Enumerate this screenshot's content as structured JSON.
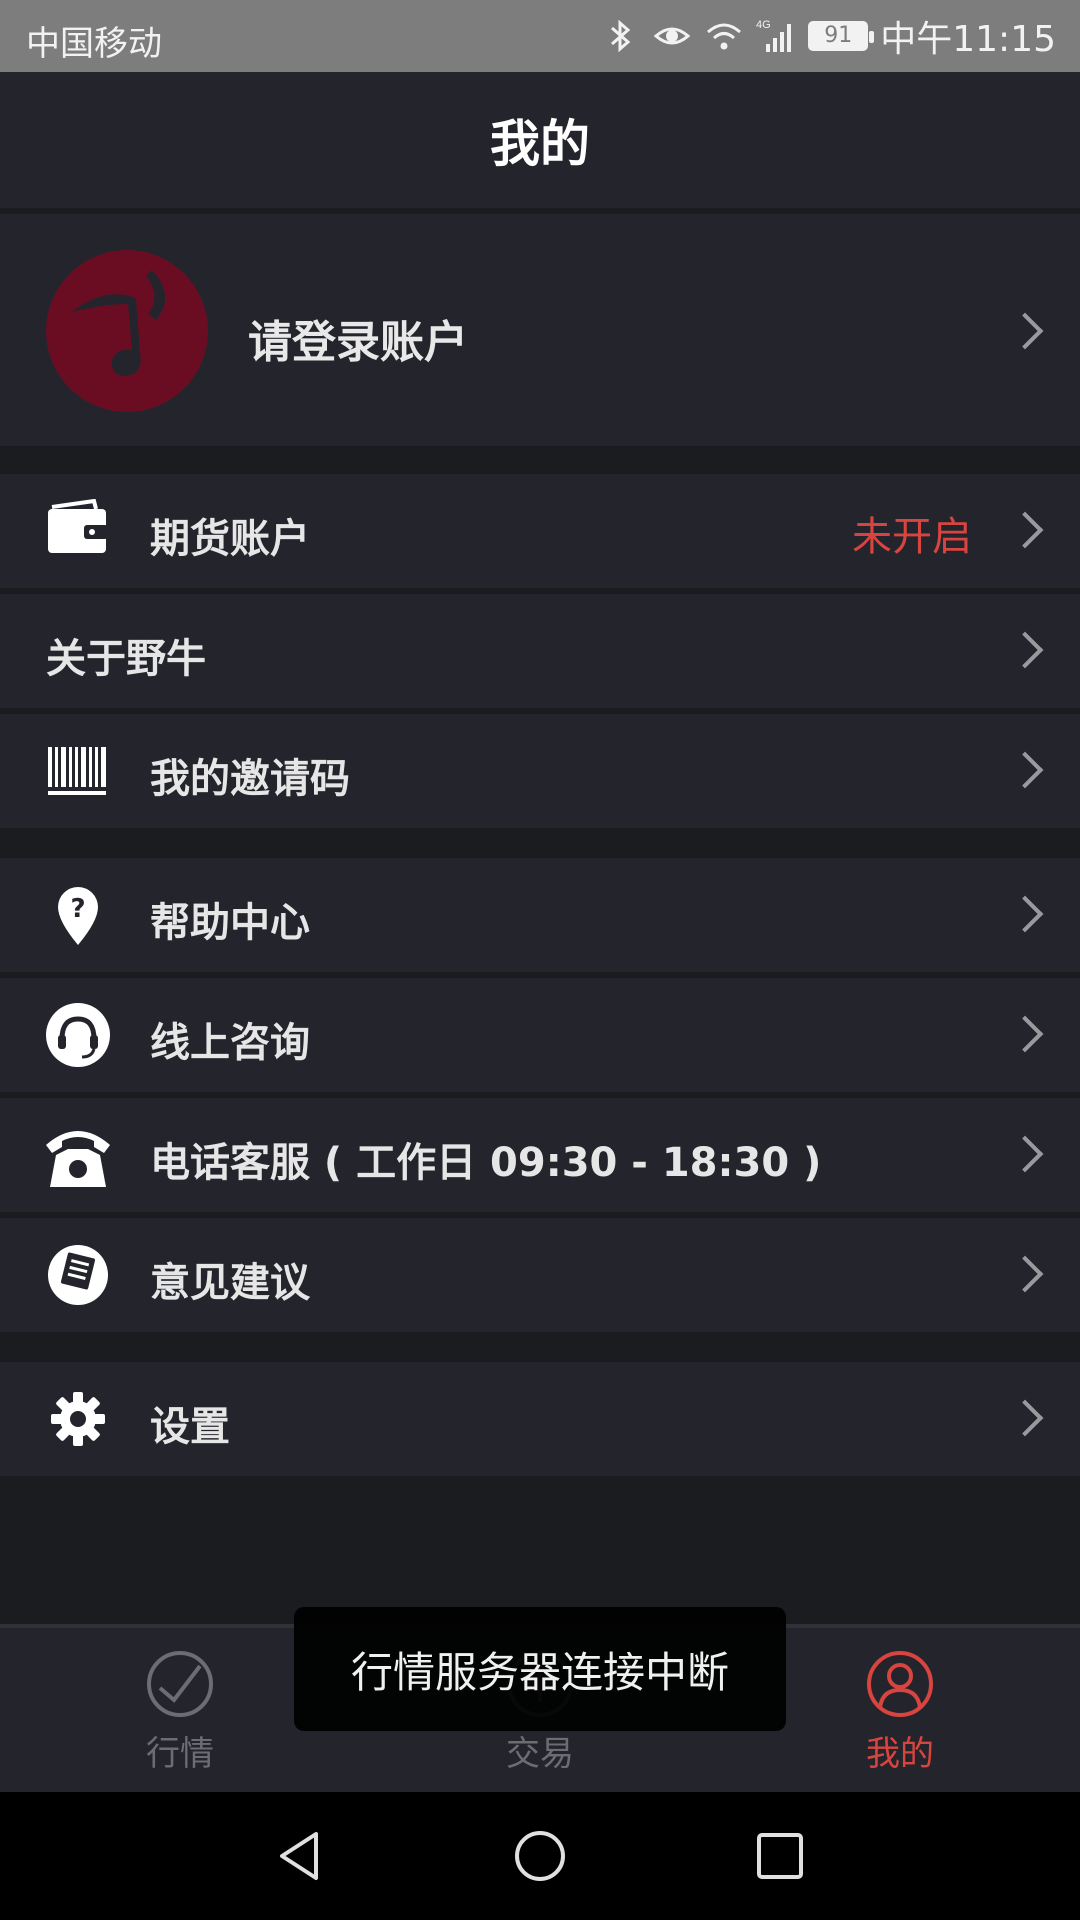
{
  "status_bar": {
    "carrier": "中国移动",
    "battery": "91",
    "time": "中午11:15"
  },
  "header": {
    "title": "我的"
  },
  "profile": {
    "login_text": "请登录账户"
  },
  "menu": {
    "futures_account": {
      "label": "期货账户",
      "status": "未开启",
      "icon": "wallet-icon"
    },
    "about": {
      "label": "关于野牛"
    },
    "invite_code": {
      "label": "我的邀请码",
      "icon": "barcode-icon"
    },
    "help_center": {
      "label": "帮助中心",
      "icon": "help-pin-icon"
    },
    "online_consult": {
      "label": "线上咨询",
      "icon": "headset-icon"
    },
    "phone_service": {
      "label": "电话客服 ( 工作日 09:30 - 18:30 )",
      "icon": "phone-icon"
    },
    "feedback": {
      "label": "意见建议",
      "icon": "feedback-icon"
    },
    "settings": {
      "label": "设置",
      "icon": "gear-icon"
    }
  },
  "tabs": [
    {
      "label": "行情",
      "icon": "market-icon",
      "active": false
    },
    {
      "label": "交易",
      "icon": "trade-icon",
      "active": false
    },
    {
      "label": "我的",
      "icon": "profile-icon",
      "active": true
    }
  ],
  "toast": {
    "message": "行情服务器连接中断"
  },
  "colors": {
    "accent": "#d8443f",
    "card": "#24252c",
    "background": "#1b1c1f",
    "avatar": "#6b0d22"
  }
}
